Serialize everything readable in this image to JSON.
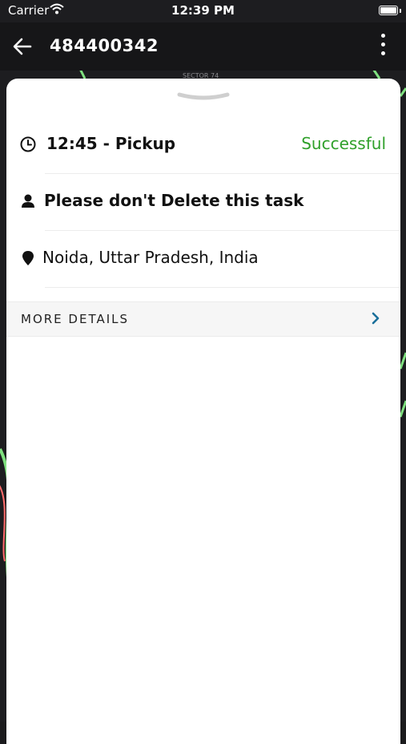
{
  "status_bar": {
    "carrier": "Carrier",
    "time": "12:39 PM"
  },
  "header": {
    "title": "484400342"
  },
  "map": {
    "label": "SECTOR 74"
  },
  "task": {
    "pickup_time": "12:45 - Pickup",
    "status": "Successful",
    "status_color": "#2fa02a",
    "name": "Please don't Delete this task",
    "address": "Noida, Uttar Pradesh, India"
  },
  "details": {
    "label": "MORE DETAILS"
  },
  "icons": [
    "back-arrow-icon",
    "more-vertical-icon",
    "clock-icon",
    "person-icon",
    "location-pin-icon",
    "chevron-right-icon",
    "wifi-icon",
    "battery-icon"
  ]
}
